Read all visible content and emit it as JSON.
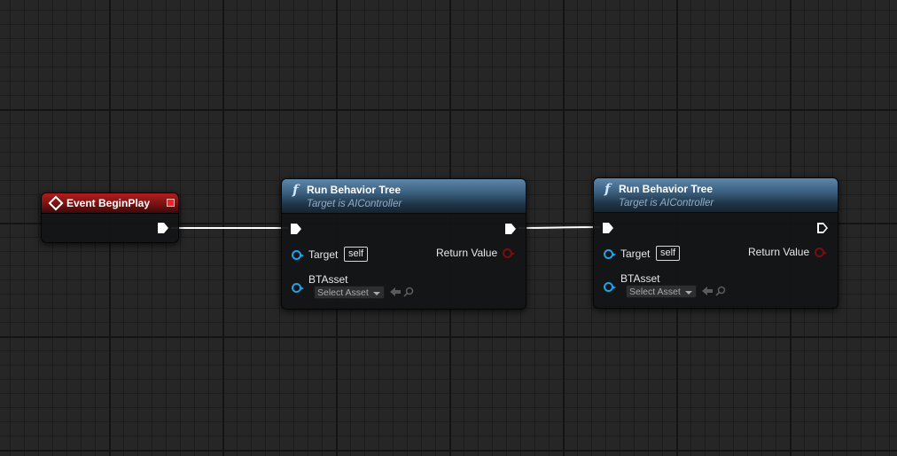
{
  "colors": {
    "event_header": "#b21d1d",
    "function_header": "#3b607f",
    "object_pin": "#1fa3e8",
    "boolean_pin": "#7a0d0d",
    "exec_wire": "#ffffff",
    "grid_bg": "#262626"
  },
  "event_node": {
    "title": "Event BeginPlay",
    "icon": "event-diamond-icon"
  },
  "nodes": [
    {
      "title": "Run Behavior Tree",
      "subtitle": "Target is AIController",
      "icon": "function-icon",
      "target_label": "Target",
      "target_default": "self",
      "asset_label": "BTAsset",
      "asset_placeholder": "Select Asset",
      "return_label": "Return Value"
    },
    {
      "title": "Run Behavior Tree",
      "subtitle": "Target is AIController",
      "icon": "function-icon",
      "target_label": "Target",
      "target_default": "self",
      "asset_label": "BTAsset",
      "asset_placeholder": "Select Asset",
      "return_label": "Return Value"
    }
  ]
}
